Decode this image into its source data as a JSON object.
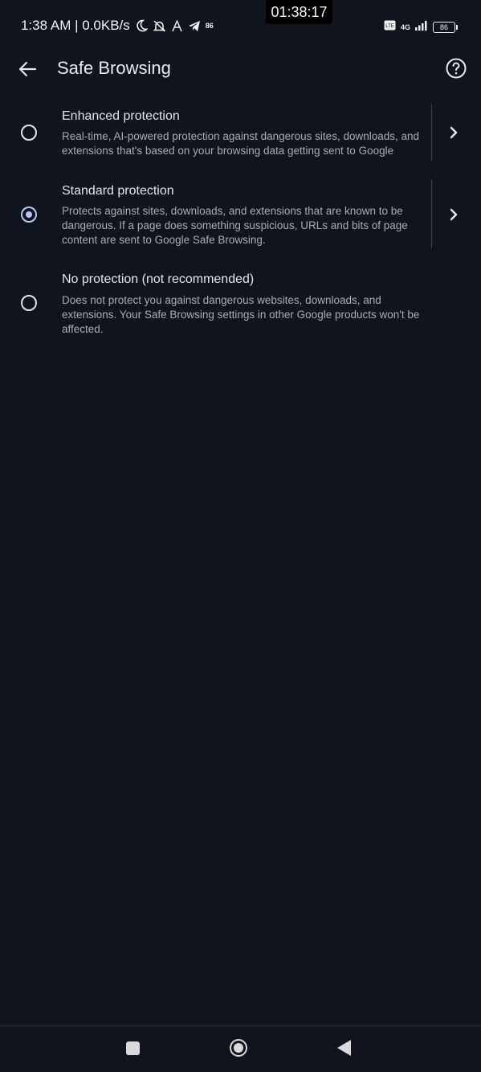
{
  "status_bar": {
    "time_speed": "1:38 AM | 0.0KB/s",
    "small_badge": "86",
    "clock": "01:38:17",
    "network": "4G",
    "battery": "86",
    "icons": [
      "moon-icon",
      "bell-off-icon",
      "font-icon",
      "telegram-icon",
      "volte-icon",
      "signal-icon",
      "battery-icon"
    ]
  },
  "app_bar": {
    "title": "Safe Browsing",
    "back_icon": "arrow-left-icon",
    "help_icon": "help-circle-icon"
  },
  "options": [
    {
      "title": "Enhanced protection",
      "desc": "Real-time, AI-powered protection against dangerous sites, downloads, and extensions that's based on your browsing data getting sent to Google",
      "selected": false,
      "has_chevron": true
    },
    {
      "title": "Standard protection",
      "desc": "Protects against sites, downloads, and extensions that are known to be dangerous. If a page does something suspicious, URLs and bits of page content are sent to Google Safe Browsing.",
      "selected": true,
      "has_chevron": true
    },
    {
      "title": "No protection (not recommended)",
      "desc": "Does not protect you against dangerous websites, downloads, and extensions. Your Safe Browsing settings in other Google products won't be affected.",
      "selected": false,
      "has_chevron": false
    }
  ],
  "colors": {
    "background": "#11141c",
    "accent": "#b4c5ff",
    "text_primary": "#e3e5ee",
    "text_secondary": "#a7abb8"
  },
  "nav_bar": {
    "icons": [
      "recents-square-icon",
      "home-circle-icon",
      "back-triangle-icon"
    ]
  }
}
